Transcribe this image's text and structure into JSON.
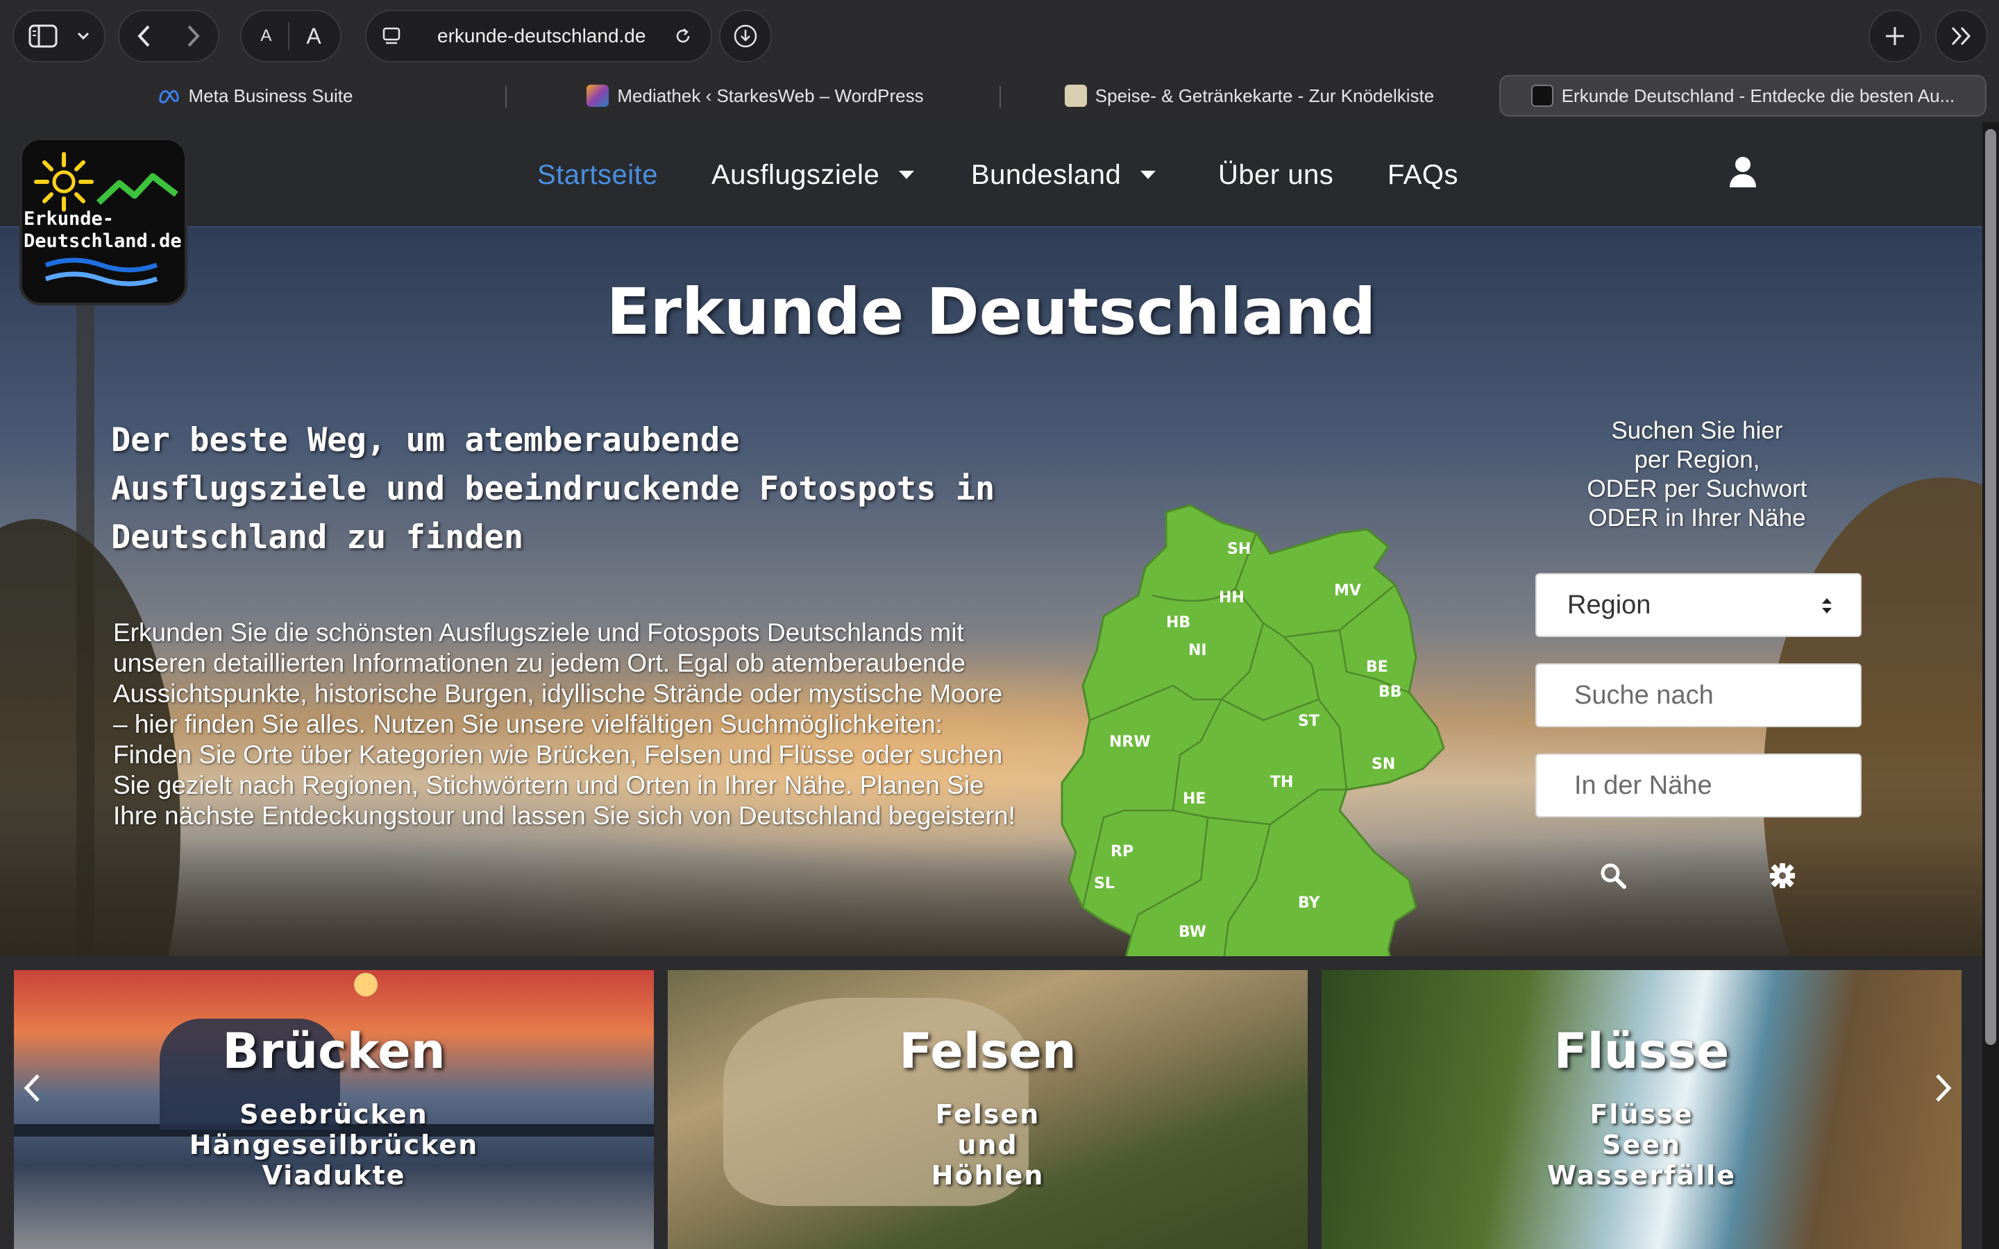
{
  "browser": {
    "url": "erkunde-deutschland.de",
    "font_small": "A",
    "font_large": "A",
    "tabs": [
      {
        "label": "Meta Business Suite",
        "favicon_color": "#1877f2"
      },
      {
        "label": "Mediathek ‹ StarkesWeb – WordPress",
        "favicon_color": "#6c5ce7"
      },
      {
        "label": "Speise- & Getränkekarte - Zur Knödelkiste",
        "favicon_color": "#c8b88a"
      },
      {
        "label": "Erkunde Deutschland - Entdecke die besten Au...",
        "favicon_color": "#111111"
      }
    ]
  },
  "site": {
    "logo_text_line1": "Erkunde-",
    "logo_text_line2": "Deutschland.de",
    "nav": {
      "home": "Startseite",
      "destinations": "Ausflugsziele",
      "state": "Bundesland",
      "about": "Über uns",
      "faq": "FAQs"
    },
    "accent_color": "#4a90e2",
    "map_color": "#6cba3c"
  },
  "hero": {
    "title": "Erkunde Deutschland",
    "tagline": "Der beste Weg, um atemberaubende Ausflugsziele und beeindruckende Fotospots in Deutschland zu finden",
    "description": "Erkunden Sie die schönsten Ausflugsziele und Fotospots Deutschlands mit unseren detaillierten Informationen zu jedem Ort. Egal ob atemberaubende Aussichtspunkte, historische Burgen, idyllische Strände oder mystische Moore – hier finden Sie alles. Nutzen Sie unsere vielfältigen Suchmöglichkeiten: Finden Sie Orte über Kategorien wie Brücken, Felsen und Flüsse oder suchen Sie gezielt nach Regionen, Stichwörtern und Orten in Ihrer Nähe. Planen Sie Ihre nächste Entdeckungstour und lassen Sie sich von Deutschland begeistern!"
  },
  "map": {
    "states": [
      "SH",
      "HH",
      "MV",
      "HB",
      "NI",
      "BE",
      "BB",
      "ST",
      "NRW",
      "SN",
      "TH",
      "HE",
      "RP",
      "SL",
      "BY",
      "BW"
    ]
  },
  "search": {
    "info_line1": "Suchen Sie hier",
    "info_line2": "per Region,",
    "info_line3": "ODER per Suchwort",
    "info_line4": "ODER in Ihrer Nähe",
    "region_select": "Region",
    "keyword_placeholder": "Suche nach",
    "nearby_placeholder": "In der Nähe"
  },
  "cards": [
    {
      "title": "Brücken",
      "lines": [
        "Seebrücken",
        "Hängeseilbrücken",
        "Viadukte"
      ]
    },
    {
      "title": "Felsen",
      "lines": [
        "Felsen",
        "und",
        "Höhlen"
      ]
    },
    {
      "title": "Flüsse",
      "lines": [
        "Flüsse",
        "Seen",
        "Wasserfälle"
      ]
    }
  ]
}
